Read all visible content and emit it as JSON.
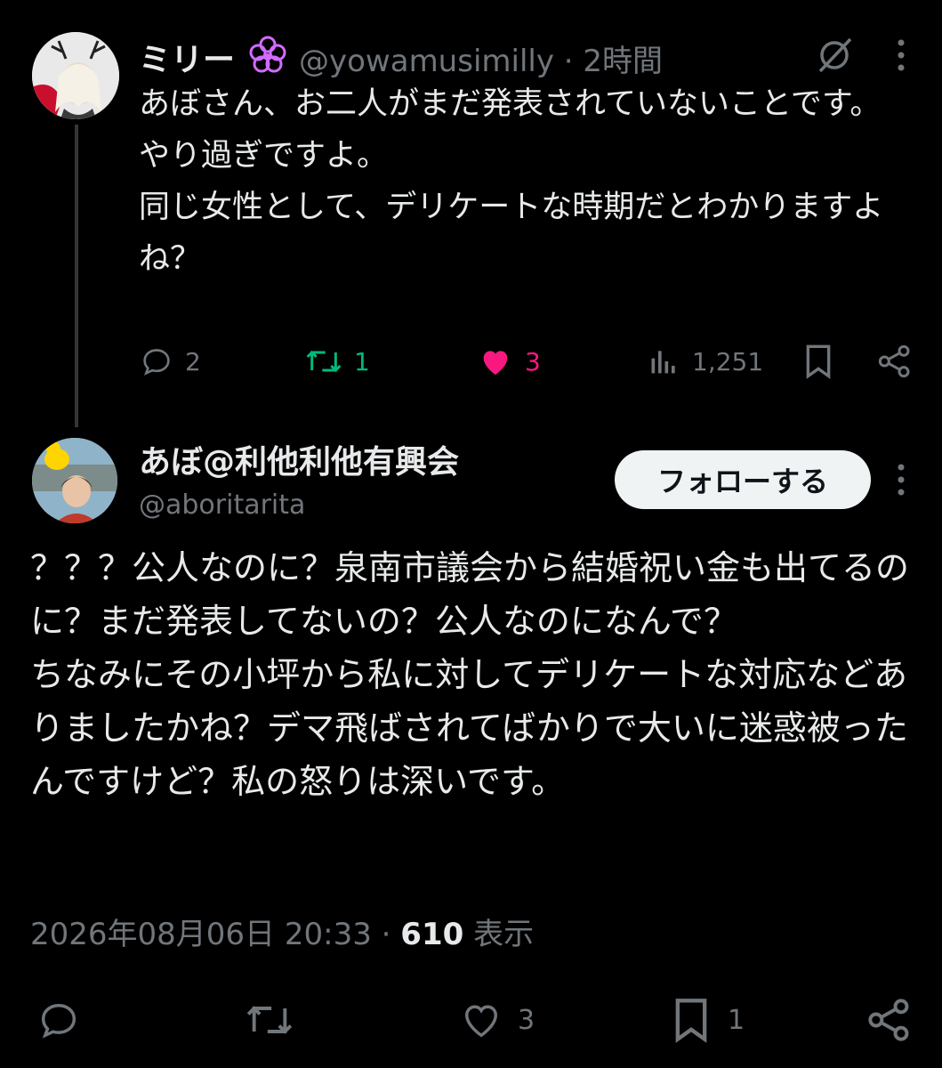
{
  "reply_tweet": {
    "display_name": "ミリー",
    "handle": "@yowamusimilly",
    "time_ago": "2時間",
    "separator": "·",
    "text": "あぼさん、お二人がまだ発表されていないことです。\nやり過ぎですよ。\n同じ女性として、デリケートな時期だとわかりますよね？",
    "replies": "2",
    "reposts": "1",
    "likes": "3",
    "views": "1,251",
    "colors": {
      "repost": "#00ba7c",
      "like": "#f91880",
      "flower": "#d26bff"
    }
  },
  "main_tweet": {
    "display_name": "あぼ@利他利他有興会",
    "handle": "@aboritarita",
    "follow_label": "フォローする",
    "text": "？？？公人なのに？泉南市議会から結婚祝い金も出てるのに？まだ発表してないの？公人なのになんで？\nちなみにその小坪から私に対してデリケートな対応などありましたかね？デマ飛ばされてばかりで大いに迷惑被ったんですけど？私の怒りは深いです。",
    "date": "2026年08月06日 20:33",
    "separator": "·",
    "views_count": "610",
    "views_label": "表示",
    "likes": "3",
    "bookmarks": "1"
  }
}
